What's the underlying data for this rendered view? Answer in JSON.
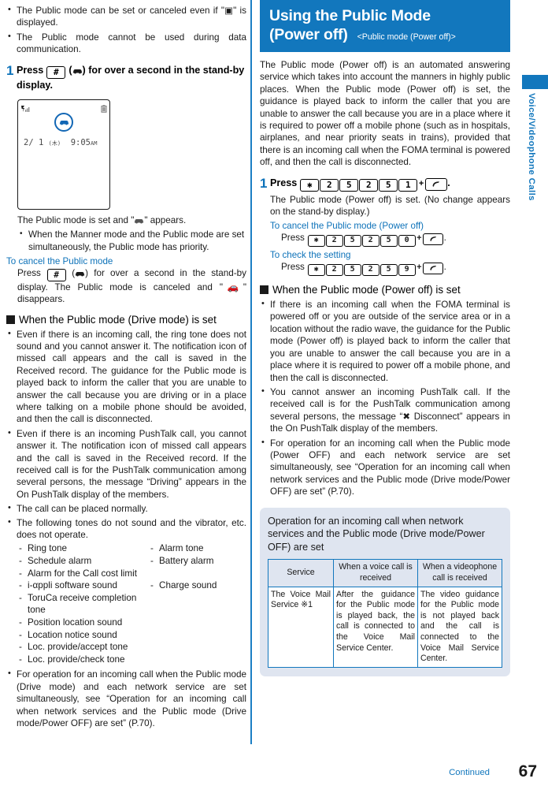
{
  "left_column": {
    "top_bullets": [
      "The Public mode can be set or canceled even if \"▣\" is displayed.",
      "The Public mode cannot be used during data communication."
    ],
    "step1": {
      "number": "1",
      "press_label": "Press",
      "keys": [
        "#"
      ],
      "icon": "car-icon",
      "title_tail": "for over a second in the stand-by display."
    },
    "phone_screen": {
      "signal_icon": "signal-icon",
      "battery_icon": "battery-icon",
      "drive_icon": "car-icon",
      "date": "2/ 1",
      "day": "(木)",
      "time": "9:05",
      "ampm": "AM"
    },
    "caption": "The Public mode is set and \"🚗\" appears.",
    "caption_sub_bullet": "When the Manner mode and the Public mode are set simultaneously, the Public mode has priority.",
    "cancel_head": "To cancel the Public mode",
    "cancel_body_pre": "Press",
    "cancel_body_post": "for over a second in the stand-by display. The Public mode is canceled and \"🚗\" disappears.",
    "drive_heading": "When the Public mode (Drive mode) is set",
    "drive_bullets": [
      "Even if there is an incoming call, the ring tone does not sound and you cannot answer it. The notification icon of missed call appears and the call is saved in the Received record. The guidance for the Public mode is played back to inform the caller that you are unable to answer the call because you are driving or in a place where talking on a mobile phone should be avoided, and then the call is disconnected.",
      "Even if there is an incoming PushTalk call, you cannot answer it. The notification icon of missed call appears and the call is saved in the Received record. If the received call is for the PushTalk communication among several persons, the message “Driving” appears in the On PushTalk display of the members.",
      "The call can be placed normally.",
      "The following tones do not sound and the vibrator, etc. does not operate."
    ],
    "tone_rows": [
      [
        "Ring tone",
        "Alarm tone"
      ],
      [
        "Schedule alarm",
        "Battery alarm"
      ],
      [
        "Alarm for the Call cost limit",
        ""
      ],
      [
        "i-αppli software sound",
        "Charge sound"
      ],
      [
        "ToruCa receive completion tone",
        ""
      ],
      [
        "Position location sound",
        ""
      ],
      [
        "Location notice sound",
        ""
      ],
      [
        "Loc. provide/accept tone",
        ""
      ],
      [
        "Loc. provide/check tone",
        ""
      ]
    ],
    "last_bullet": "For operation for an incoming call when the Public mode (Drive mode) and each network service are set simultaneously, see “Operation for an incoming call when network services and the Public mode (Drive mode/Power OFF) are set” (P.70)."
  },
  "right_column": {
    "banner": {
      "title_line1": "Using the Public Mode",
      "title_line2": "(Power off)",
      "subtitle": "<Public mode (Power off)>"
    },
    "intro": "The Public mode (Power off) is an automated answering service which takes into account the manners in highly public places. When the Public mode (Power off) is set, the guidance is played back to inform the caller that you are unable to answer the call because you are in a place where it is required to power off a mobile phone (such as in hospitals, airplanes, and near priority seats in trains), provided that there is an incoming call when the FOMA terminal is powered off, and then the call is disconnected.",
    "step1": {
      "number": "1",
      "press_label": "Press",
      "keys": [
        "✱",
        "2",
        "5",
        "2",
        "5",
        "1"
      ],
      "plus": "+",
      "call_key": "call-key",
      "period": ".",
      "desc": "The Public mode (Power off) is set. (No change appears on the stand-by display.)"
    },
    "cancel_head": "To cancel the Public mode (Power off)",
    "cancel_press": "Press",
    "cancel_keys": [
      "✱",
      "2",
      "5",
      "2",
      "5",
      "0"
    ],
    "check_head": "To check the setting",
    "check_press": "Press",
    "check_keys": [
      "✱",
      "2",
      "5",
      "2",
      "5",
      "9"
    ],
    "poweroff_heading": "When the Public mode (Power off) is set",
    "poweroff_bullets": [
      "If there is an incoming call when the FOMA terminal is powered off or you are outside of the service area or in a location without the radio wave, the guidance for the Public mode (Power off) is played back to inform the caller that you are unable to answer the call because you are in a place where it is required to power off a mobile phone, and then the call is disconnected.",
      "You cannot answer an incoming PushTalk call. If the received call is for the PushTalk communication among several persons, the message “✖ Disconnect” appears in the On PushTalk display of the members.",
      "For operation for an incoming call when the Public mode (Power OFF) and each network service are set simultaneously, see “Operation for an incoming call when network services and the Public mode (Drive mode/Power OFF) are set” (P.70)."
    ],
    "info_box": {
      "title": "Operation for an incoming call when network services and the Public mode (Drive mode/Power OFF) are set",
      "headers": [
        "Service",
        "When a voice call is received",
        "When a videophone call is received"
      ],
      "rows": [
        {
          "service": "The Voice Mail Service ※1",
          "voice": "After the guidance for the Public mode is played back, the call is connected to the Voice Mail Service Center.",
          "video": "The video guidance for the Public mode is not played back and the call is connected to the Voice Mail Service Center."
        }
      ]
    }
  },
  "side_tab": {
    "label": "Voice/Videophone Calls"
  },
  "footer": {
    "continued": "Continued",
    "page_number": "67"
  },
  "colors": {
    "accent_blue": "#1277bd",
    "heading_blue": "#0d72b9",
    "info_box_bg": "#dfe5f0",
    "text": "#1a1a1a"
  }
}
